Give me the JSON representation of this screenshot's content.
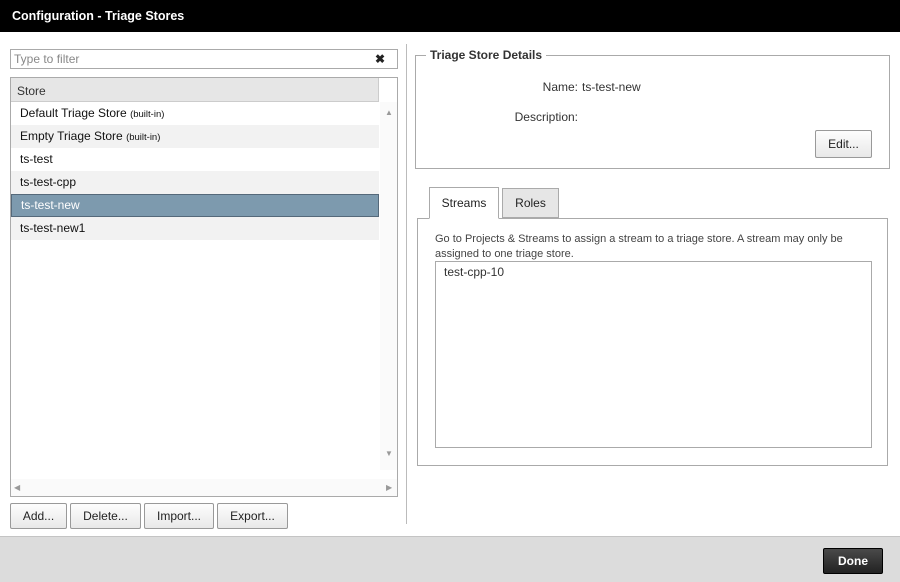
{
  "window": {
    "title": "Configuration - Triage Stores"
  },
  "filter": {
    "placeholder": "Type to filter",
    "value": ""
  },
  "store_list": {
    "column_header": "Store",
    "rows": [
      {
        "label": "Default Triage Store",
        "tag": "(built-in)",
        "selected": false
      },
      {
        "label": "Empty Triage Store",
        "tag": "(built-in)",
        "selected": false
      },
      {
        "label": "ts-test",
        "tag": "",
        "selected": false
      },
      {
        "label": "ts-test-cpp",
        "tag": "",
        "selected": false
      },
      {
        "label": "ts-test-new",
        "tag": "",
        "selected": true
      },
      {
        "label": "ts-test-new1",
        "tag": "",
        "selected": false
      }
    ]
  },
  "list_buttons": {
    "add": "Add...",
    "delete": "Delete...",
    "import": "Import...",
    "export": "Export..."
  },
  "details": {
    "legend": "Triage Store Details",
    "name_label": "Name:",
    "name_value": "ts-test-new",
    "description_label": "Description:",
    "description_value": "",
    "edit_button": "Edit..."
  },
  "tabs": [
    {
      "label": "Streams",
      "active": true
    },
    {
      "label": "Roles",
      "active": false
    }
  ],
  "streams_panel": {
    "help_text": "Go to Projects & Streams to assign a stream to a triage store. A stream may only be assigned to one triage store.",
    "items": [
      "test-cpp-10"
    ]
  },
  "footer": {
    "done_button": "Done"
  },
  "colors": {
    "titlebar": "#000000",
    "selection": "#7d9aae",
    "footer": "#dcdcdc",
    "done_button": "#333333"
  }
}
